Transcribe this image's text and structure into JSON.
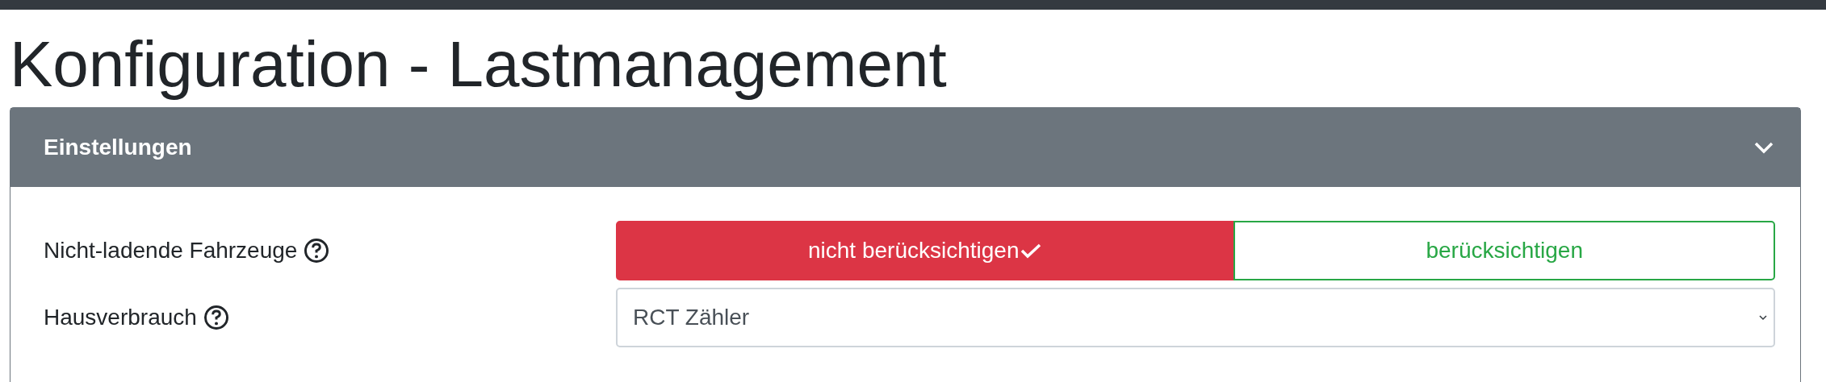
{
  "title": "Konfiguration - Lastmanagement",
  "card": {
    "title": "Einstellungen",
    "expanded": true,
    "rows": [
      {
        "kind": "toggle",
        "label": "Nicht-ladende Fahrzeuge",
        "options": [
          {
            "label": "nicht berücksichtigen",
            "selected": true,
            "color": "#dc3545"
          },
          {
            "label": "berücksichtigen",
            "selected": false,
            "color": "#28a745"
          }
        ]
      },
      {
        "kind": "select",
        "label": "Hausverbrauch",
        "value": "RCT Zähler"
      }
    ]
  }
}
